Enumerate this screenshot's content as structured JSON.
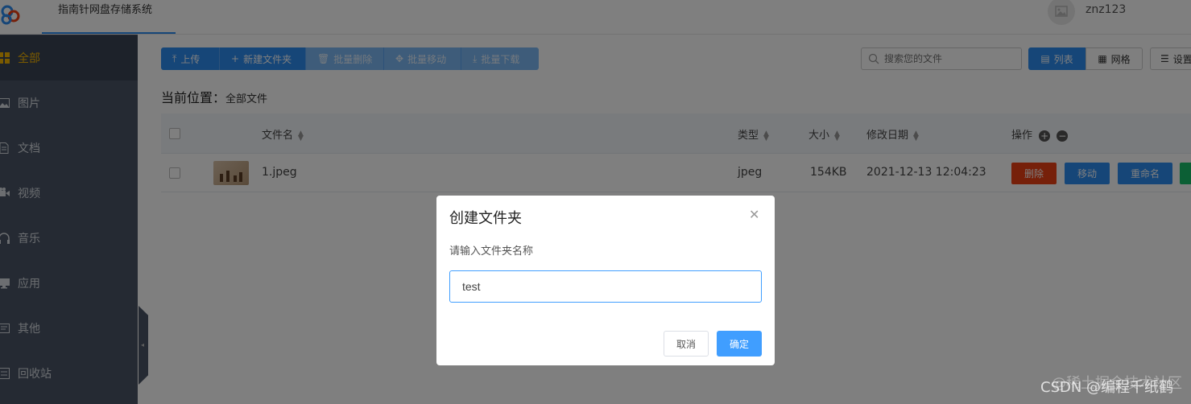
{
  "header": {
    "app_title": "指南针网盘存储系统",
    "username": "znz123"
  },
  "sidebar": {
    "items": [
      {
        "label": "全部",
        "icon": "grid-icon",
        "active": true
      },
      {
        "label": "图片",
        "icon": "image-icon"
      },
      {
        "label": "文档",
        "icon": "document-icon"
      },
      {
        "label": "视频",
        "icon": "video-icon"
      },
      {
        "label": "音乐",
        "icon": "headphones-icon"
      },
      {
        "label": "应用",
        "icon": "monitor-icon"
      },
      {
        "label": "其他",
        "icon": "other-icon"
      },
      {
        "label": "回收站",
        "icon": "trash-icon"
      }
    ]
  },
  "toolbar": {
    "upload": "上传",
    "new_folder": "新建文件夹",
    "batch_delete": "批量删除",
    "batch_move": "批量移动",
    "batch_download": "批量下载"
  },
  "search": {
    "placeholder": "搜索您的文件"
  },
  "view": {
    "list": "列表",
    "grid": "网格",
    "settings": "设置"
  },
  "breadcrumb": {
    "label": "当前位置：",
    "current": "全部文件"
  },
  "table": {
    "headers": {
      "name": "文件名",
      "type": "类型",
      "size": "大小",
      "modified": "修改日期",
      "actions": "操作"
    },
    "rows": [
      {
        "name": "1.jpeg",
        "type": "jpeg",
        "size": "154KB",
        "modified": "2021-12-13 12:04:23",
        "actions": {
          "delete": "删除",
          "move": "移动",
          "rename": "重命名"
        }
      }
    ]
  },
  "modal": {
    "title": "创建文件夹",
    "label": "请输入文件夹名称",
    "input_value": "test",
    "cancel": "取消",
    "confirm": "确定"
  },
  "watermark": {
    "line1": "@稀土掘金技术社区",
    "line2": "CSDN @编程千纸鹤"
  },
  "colors": {
    "primary": "#2d8cf0",
    "sidebar_bg": "#4a5566",
    "sidebar_active_text": "#f5b400",
    "delete_btn": "#ed4014",
    "move_btn": "#2d8cf0",
    "rename_btn": "#2d8cf0",
    "extra_btn": "#19be6b",
    "modal_primary": "#409eff"
  }
}
